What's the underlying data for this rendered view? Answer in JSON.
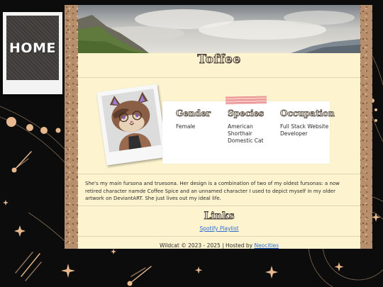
{
  "nav": {
    "home_label": "HOME"
  },
  "profile": {
    "name": "Toffee",
    "fields": [
      {
        "heading": "Gender",
        "value": "Female"
      },
      {
        "heading": "Species",
        "value": "American Shorthair Domestic Cat"
      },
      {
        "heading": "Occupation",
        "value": "Full Stack Website Developer"
      }
    ],
    "bio": "She's my main fursona and truesona. Her design is a combination of two of my oldest fursonas: a now retired character namde Coffee Spice and an unnamed character I used to depict myself in my older artwork on DeviantART. She just lives out my ideal life."
  },
  "links": {
    "heading": "Links",
    "items": [
      {
        "label": "Spotify Playlist"
      }
    ]
  },
  "footer": {
    "text": "Wildcat © 2023 - 2025 | Hosted by ",
    "host_link": "Neocities"
  },
  "colors": {
    "background": "#0c0c0c",
    "paper": "#fdf4cf",
    "cork": "#b78f6c",
    "link": "#2a6bd1",
    "decor": "#e8b98e"
  }
}
